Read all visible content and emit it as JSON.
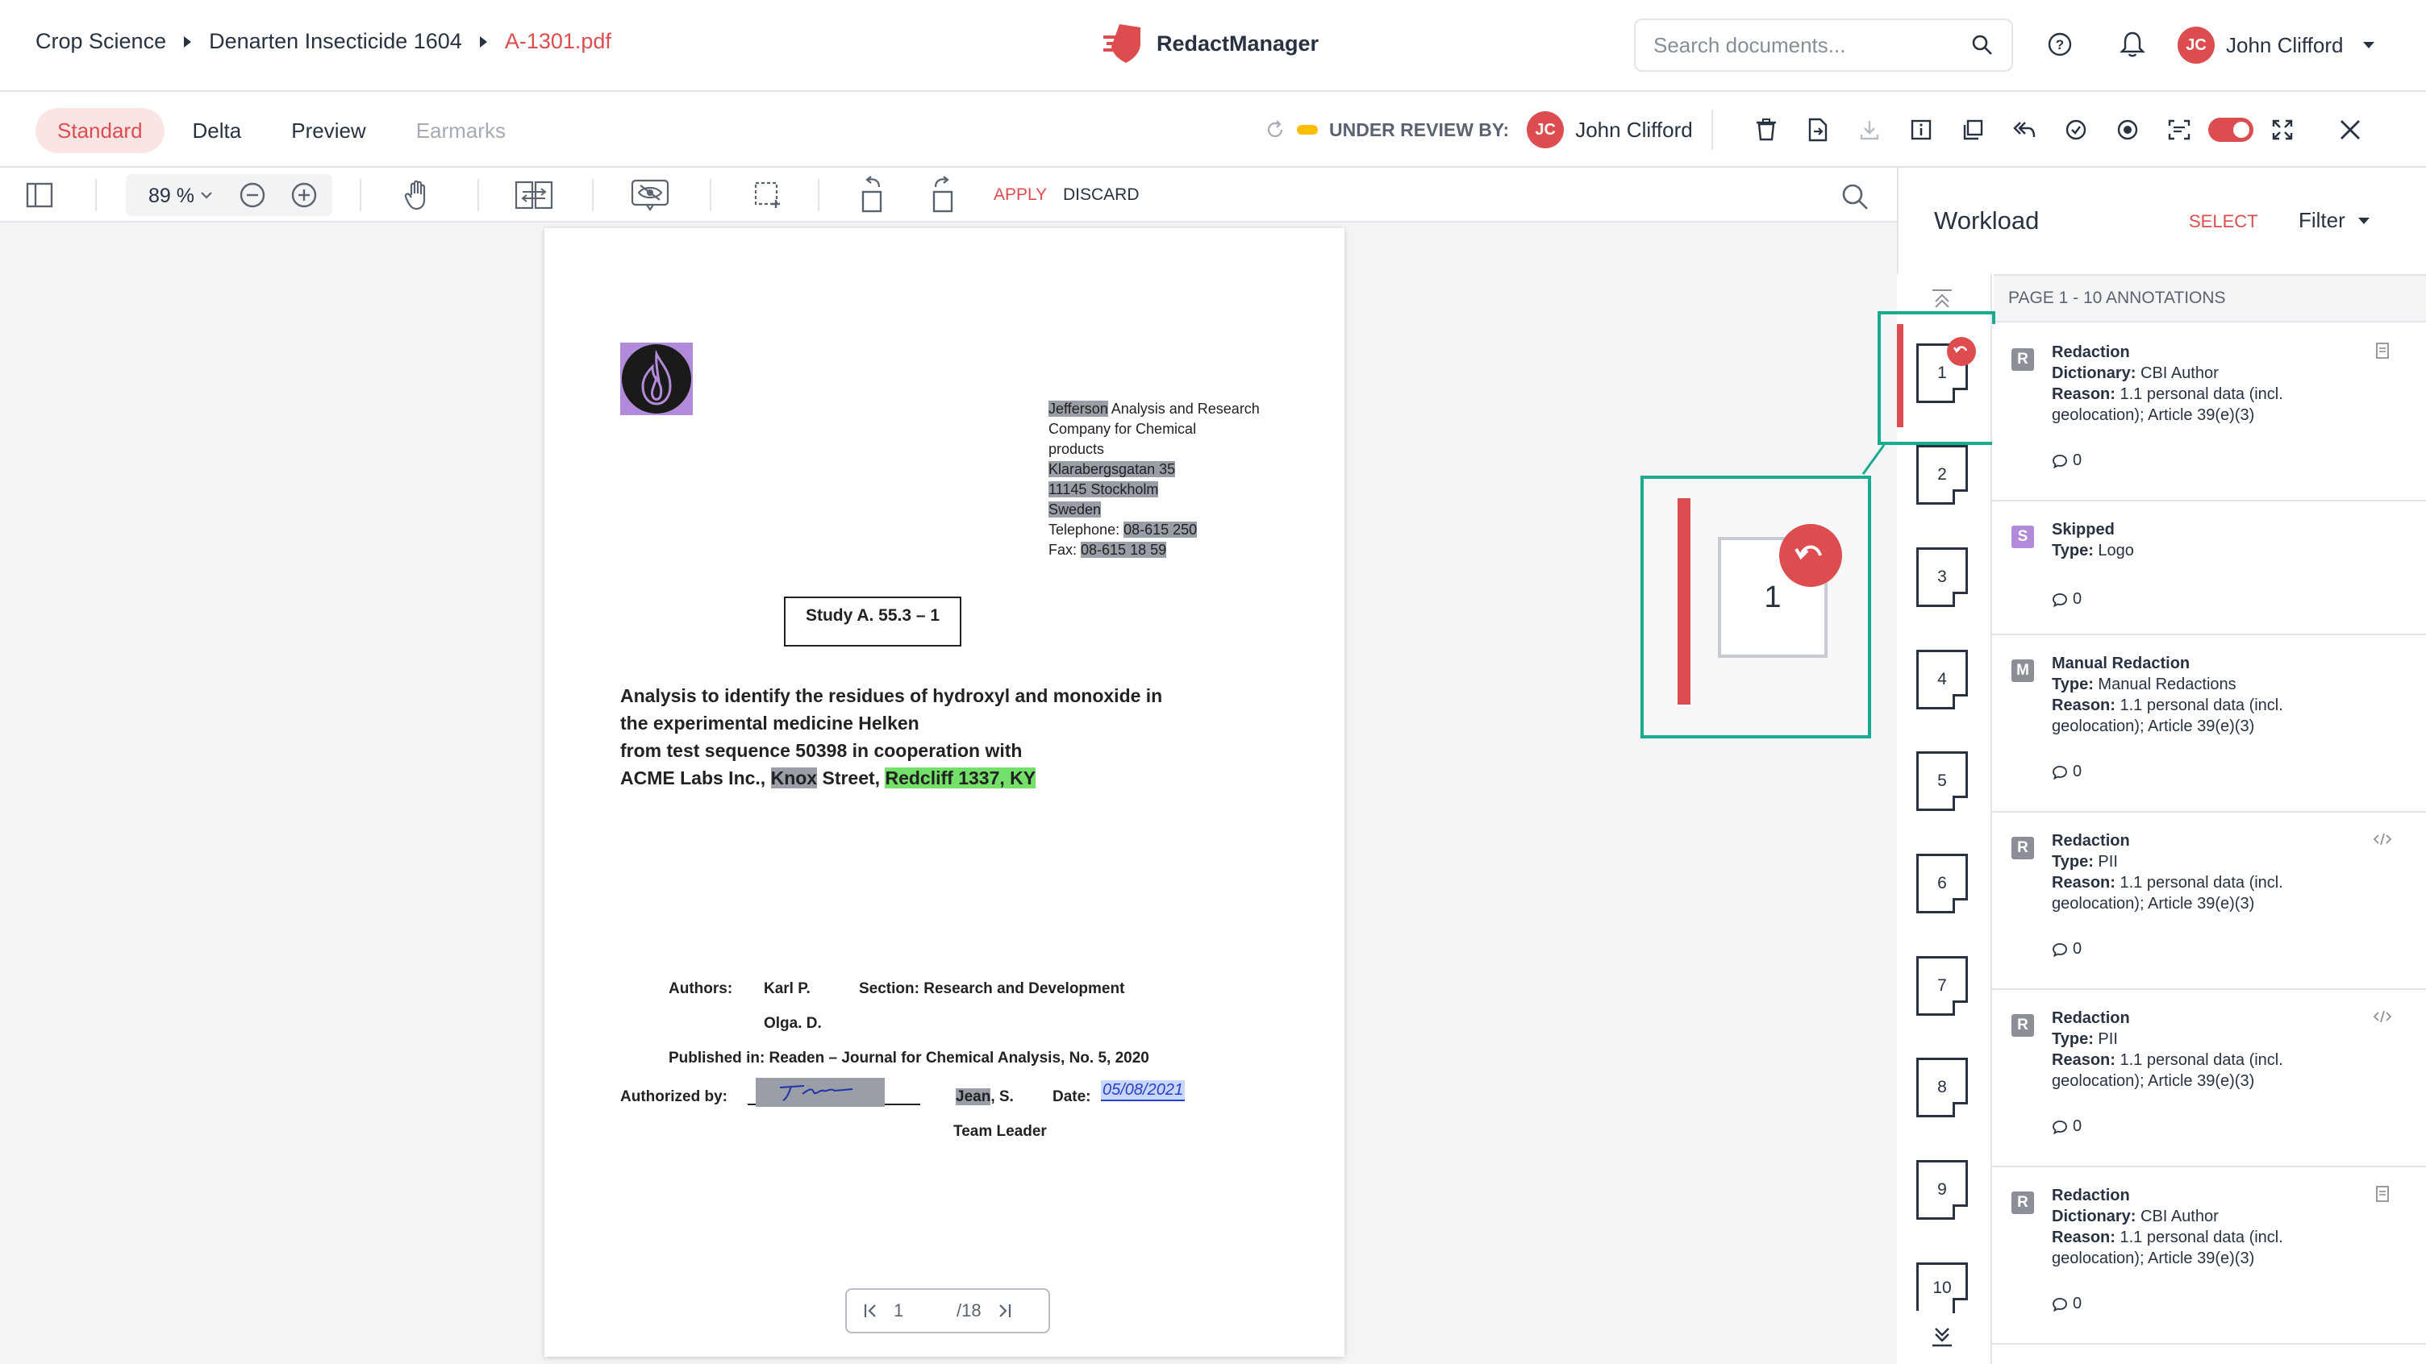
{
  "breadcrumb": {
    "root": "Crop Science",
    "dossier": "Denarten Insecticide 1604",
    "file": "A-1301.pdf"
  },
  "brand": {
    "name": "RedactManager"
  },
  "search": {
    "placeholder": "Search documents..."
  },
  "user": {
    "initials": "JC",
    "name": "John Clifford"
  },
  "tabs": {
    "standard": "Standard",
    "delta": "Delta",
    "preview": "Preview",
    "earmarks": "Earmarks"
  },
  "status": {
    "label": "UNDER REVIEW BY:",
    "reviewer_initials": "JC",
    "reviewer": "John Clifford"
  },
  "viewer_toolbar": {
    "zoom": "89 %",
    "apply": "APPLY",
    "discard": "DISCARD"
  },
  "document": {
    "address": [
      "Jefferson",
      " Analysis and Research",
      "Company for Chemical",
      "products",
      "Klarabergsgatan 35",
      "11145 Stockholm",
      "Sweden",
      "Telephone: ",
      "08-615 250",
      "Fax: ",
      "08-615 18 59"
    ],
    "study_box": "Study A. 55.3 – 1",
    "title_line1": "Analysis to identify the residues of hydroxyl and monoxide in",
    "title_line2": "the experimental medicine Helken",
    "title_line3": "from test sequence 50398 in cooperation with",
    "title_line4_a": "ACME Labs Inc., ",
    "title_line4_b": "Knox",
    "title_line4_c": " Street, ",
    "title_line4_d": "Redcliff 1337, KY",
    "authors_label": "Authors:",
    "author1": "Karl P.",
    "section": "Section: Research and Development",
    "author2": "Olga. D.",
    "published": "Published in: Readen – Journal for Chemical Analysis, No. 5, 2020",
    "authorized_label": "Authorized by:",
    "signer_a": "Jean",
    "signer_b": ", S.",
    "date_label": "Date:",
    "date_value": "05/08/2021",
    "team_leader": "Team Leader"
  },
  "pager": {
    "current": "1",
    "total": "/18"
  },
  "workload": {
    "title": "Workload",
    "select": "SELECT",
    "filter": "Filter",
    "page_header": "PAGE 1 - 10 ANNOTATIONS",
    "pages": [
      "1",
      "2",
      "3",
      "4",
      "5",
      "6",
      "7",
      "8",
      "9",
      "10"
    ],
    "preview_page": "1",
    "annotations": [
      {
        "tag": "R",
        "tag_color": "#8c9096",
        "title": "Redaction",
        "k1": "Dictionary:",
        "v1": " CBI Author",
        "k2": "Reason:",
        "v2": " 1.1 personal data (incl. geolocation); Article 39(e)(3)",
        "comments": "0",
        "action_icon": "document-icon"
      },
      {
        "tag": "S",
        "tag_color": "#b18bd9",
        "title": "Skipped",
        "k1": "Type:",
        "v1": " Logo",
        "k2": "",
        "v2": "",
        "comments": "0",
        "action_icon": ""
      },
      {
        "tag": "M",
        "tag_color": "#8c9096",
        "title": "Manual Redaction",
        "k1": "Type:",
        "v1": " Manual Redactions",
        "k2": "Reason:",
        "v2": " 1.1 personal data (incl. geolocation); Article 39(e)(3)",
        "comments": "0",
        "action_icon": ""
      },
      {
        "tag": "R",
        "tag_color": "#8c9096",
        "title": "Redaction",
        "k1": "Type:",
        "v1": " PII",
        "k2": "Reason:",
        "v2": " 1.1 personal data (incl. geolocation); Article 39(e)(3)",
        "comments": "0",
        "action_icon": "code-icon"
      },
      {
        "tag": "R",
        "tag_color": "#8c9096",
        "title": "Redaction",
        "k1": "Type:",
        "v1": " PII",
        "k2": "Reason:",
        "v2": " 1.1 personal data (incl. geolocation); Article 39(e)(3)",
        "comments": "0",
        "action_icon": "code-icon"
      },
      {
        "tag": "R",
        "tag_color": "#8c9096",
        "title": "Redaction",
        "k1": "Dictionary:",
        "v1": " CBI Author",
        "k2": "Reason:",
        "v2": " 1.1 personal data (incl. geolocation); Article 39(e)(3)",
        "comments": "0",
        "action_icon": "document-icon"
      }
    ]
  },
  "colors": {
    "accent": "#dd4d50",
    "highlight_teal": "#1aab8e",
    "skipped": "#b18bd9",
    "recommendation_green": "#74e06a"
  }
}
